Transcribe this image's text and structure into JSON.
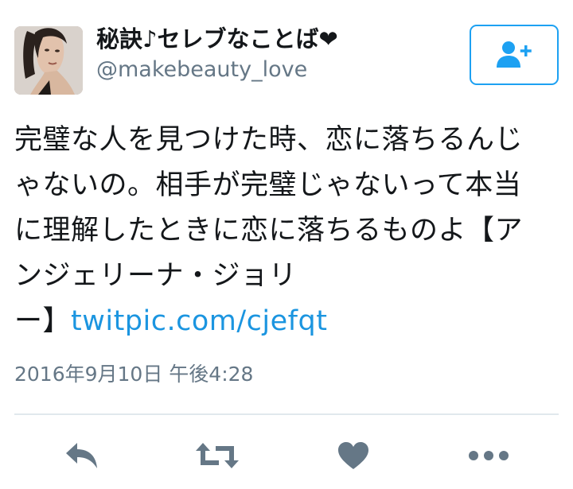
{
  "colors": {
    "accent": "#1da1f2",
    "link": "#1b95e0",
    "text": "#14171a",
    "secondary_text": "#657786",
    "icon": "#657786",
    "divider": "#e1e8ed"
  },
  "user": {
    "display_name": "秘訣♪セレブなことば❤",
    "handle": "@makebeauty_love",
    "avatar_icon": "profile-photo"
  },
  "follow_button": {
    "icon": "add-user-icon"
  },
  "tweet": {
    "text_lines": [
      "完璧な人を見つけた時、恋に落ちるんじ",
      "ゃないの。相手が完璧じゃないって本当",
      "に理解したときに恋に落ちるものよ【ア",
      "ンジェリーナ・ジョリ",
      "ー】"
    ],
    "link_text": "twitpic.com/cjefqt",
    "timestamp": "2016年9月10日 午後4:28"
  },
  "actions": [
    {
      "name": "reply",
      "icon": "reply-icon"
    },
    {
      "name": "retweet",
      "icon": "retweet-icon"
    },
    {
      "name": "like",
      "icon": "heart-icon"
    },
    {
      "name": "more",
      "icon": "more-icon"
    }
  ]
}
